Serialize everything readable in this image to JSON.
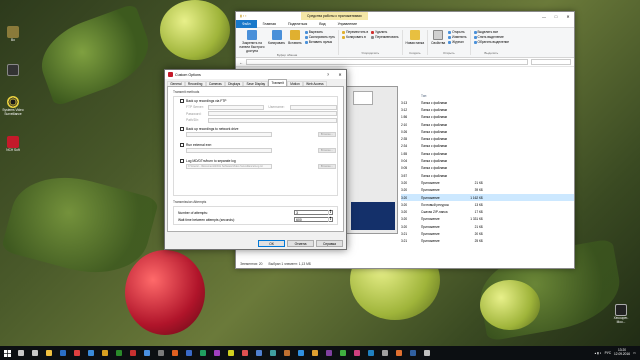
{
  "desktop": {
    "icons": [
      {
        "label": "Bo"
      },
      {
        "label": ""
      },
      {
        "label": "Systems Video Surveillance"
      },
      {
        "label": "NCH Soft"
      }
    ],
    "right_icon": {
      "label": "Xecouper-Moo..."
    }
  },
  "explorer": {
    "context_title": "Средства работы с приложениями",
    "title_controls": [
      "—",
      "□",
      "✕"
    ],
    "tabs": [
      "Файл",
      "Главная",
      "Поделиться",
      "Вид",
      "Управление"
    ],
    "ribbon": {
      "pin_label": "Закрепить на панели быстрого доступа",
      "copy_label": "Копировать",
      "paste_label": "Вставить",
      "cut_label": "Вырезать",
      "copy_path_label": "Скопировать путь",
      "paste_shortcut_label": "Вставить ярлык",
      "clipboard_group": "Буфер обмена",
      "move_label": "Переместить в",
      "copy_to_label": "Копировать в",
      "delete_label": "Удалить",
      "rename_label": "Переименовать",
      "organize_group": "Упорядочить",
      "new_folder_label": "Новая папка",
      "new_group": "Создать",
      "properties_label": "Свойства",
      "open_label": "Открыть",
      "edit_label": "Изменить",
      "history_label": "Журнал",
      "open_group": "Открыть",
      "select_all": "Выделить все",
      "select_none": "Снять выделение",
      "invert_selection": "Обратить выделение",
      "select_group": "Выделить"
    },
    "columns": [
      "Тип"
    ],
    "file_rows": [
      {
        "date": "3:13",
        "type": "Папка с файлами",
        "size": ""
      },
      {
        "date": "3:12",
        "type": "Папка с файлами",
        "size": ""
      },
      {
        "date": "1:56",
        "type": "Папка с файлами",
        "size": ""
      },
      {
        "date": "2:10",
        "type": "Папка с файлами",
        "size": ""
      },
      {
        "date": "0:26",
        "type": "Папка с файлами",
        "size": ""
      },
      {
        "date": "2:35",
        "type": "Папка с файлами",
        "size": ""
      },
      {
        "date": "2:34",
        "type": "Папка с файлами",
        "size": ""
      },
      {
        "date": "1:55",
        "type": "Папка с файлами",
        "size": ""
      },
      {
        "date": "0:04",
        "type": "Папка с файлами",
        "size": ""
      },
      {
        "date": "0:05",
        "type": "Папка с файлами",
        "size": ""
      },
      {
        "date": "3:57",
        "type": "Папка с файлами",
        "size": ""
      },
      {
        "date": "3:20",
        "type": "Приложение",
        "size": "21 КБ"
      },
      {
        "date": "3:20",
        "type": "Приложение",
        "size": "39 КБ"
      },
      {
        "date": "3:20",
        "type": "Приложение",
        "size": "1 162 КБ"
      },
      {
        "date": "3:20",
        "type": "Почтовый ресурсы",
        "size": "13 КБ"
      },
      {
        "date": "3:20",
        "type": "Сжатая ZIP-папка",
        "size": "17 КБ"
      },
      {
        "date": "3:20",
        "type": "Приложение",
        "size": "1 331 КБ"
      },
      {
        "date": "3:20",
        "type": "Приложение",
        "size": "21 КБ"
      },
      {
        "date": "3:21",
        "type": "Приложение",
        "size": "20 КБ"
      },
      {
        "date": "3:21",
        "type": "Приложение",
        "size": "25 КБ"
      }
    ],
    "status": {
      "items_count": "Элементов: 20",
      "selected": "Выбран 1 элемент: 1,13 МБ"
    }
  },
  "dialog": {
    "title": "Custom Options",
    "help": "?",
    "close": "✕",
    "tabs": [
      "General",
      "Recording",
      "Cameras",
      "Displays",
      "Save Display",
      "Transmit",
      "Motion",
      "Web Access"
    ],
    "active_tab": "Transmit",
    "transmit_methods_title": "Transmit methods",
    "backup_ftp_label": "Back up recordings via FTP",
    "ftp_server_label": "FTP Server:",
    "username_label": "Username:",
    "password_label": "Password:",
    "path_label": "Path/Dir:",
    "backup_drive_label": "Back up recordings to network drive",
    "browse_label": "Browse...",
    "run_external_label": "Run external exe:",
    "log_label": "Log MD/DTrx/burn to separate log",
    "log_path": "C:\\Users\\...\\Documents\\NCH Software\\Video Surveillance\\Log.txt",
    "attempts_title": "Transmission Attempts",
    "attempts_label": "Number of attempts:",
    "attempts_value": "3",
    "wait_label": "Wait time between attempts (seconds):",
    "wait_value": "600",
    "ok_label": "ОК",
    "cancel_label": "Отмена",
    "apply_label": "Справка"
  },
  "taskbar": {
    "language": "РУС",
    "time": "13:20",
    "date": "12.09.2016",
    "apps": [
      "search-icon",
      "task-view-icon",
      "folder-icon",
      "store-icon",
      "chrome-icon",
      "mail-icon",
      "app1",
      "app2",
      "app3",
      "app4",
      "app5",
      "app6",
      "app7",
      "app8",
      "app9",
      "app10",
      "app11",
      "app12",
      "app13",
      "app14",
      "app15",
      "app16",
      "app17",
      "app18",
      "app19",
      "app20",
      "app21",
      "app22",
      "app23",
      "app24"
    ],
    "app_colors": [
      "#c8c8c8",
      "#c8c8c8",
      "#f0c040",
      "#2a6fc8",
      "#e04040",
      "#3a8ad8",
      "#d8a020",
      "#2a8a2a",
      "#c83030",
      "#4a90e2",
      "#7a7a7a",
      "#e06020",
      "#3a6ac8",
      "#20a060",
      "#a040c0",
      "#d0d020",
      "#e05050",
      "#5080d0",
      "#40a0a0",
      "#c07030",
      "#3090e0",
      "#e0a030",
      "#8040a0",
      "#40b040",
      "#d04080",
      "#2080c0",
      "#a0a0a0",
      "#e07030",
      "#3060a0",
      "#c0c0c0"
    ]
  }
}
